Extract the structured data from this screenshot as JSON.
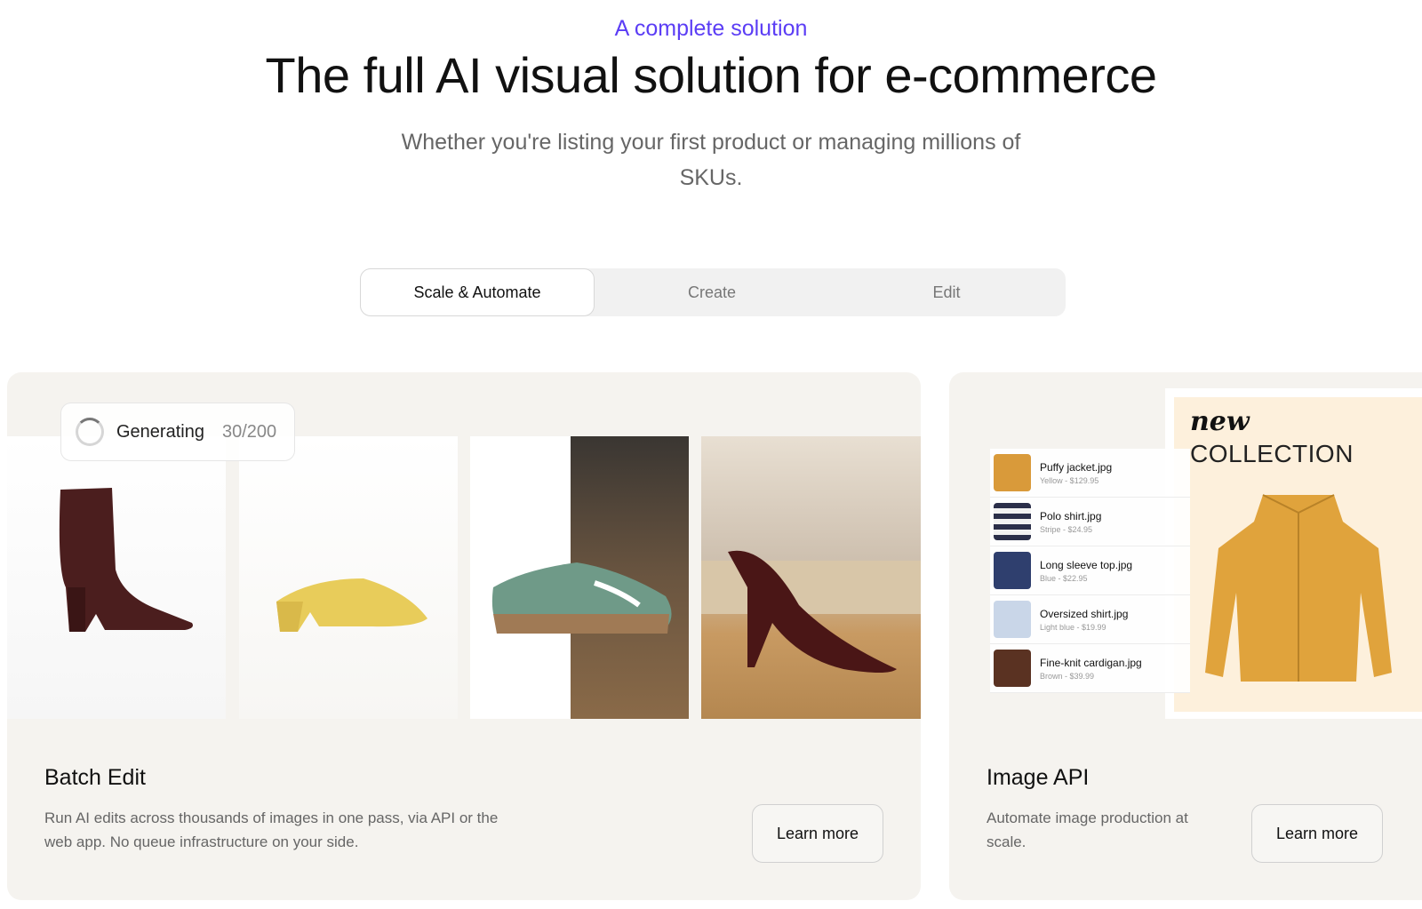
{
  "hero": {
    "eyebrow": "A complete solution",
    "title": "The full AI visual solution for e-commerce",
    "subtitle": "Whether you're listing your first product or managing millions of SKUs."
  },
  "tabs": [
    {
      "label": "Scale & Automate",
      "active": true
    },
    {
      "label": "Create",
      "active": false
    },
    {
      "label": "Edit",
      "active": false
    }
  ],
  "batch_edit": {
    "status_label": "Generating",
    "status_count": "30/200",
    "title": "Batch Edit",
    "description": "Run AI edits across thousands of images in one pass, via API or the web app. No queue infrastructure on your side.",
    "button": "Learn more"
  },
  "image_api": {
    "promo_new": "new",
    "promo_collection": "COLLECTION",
    "files": [
      {
        "name": "Puffy jacket.jpg",
        "meta": "Yellow - $129.95",
        "color": "#d99a3a"
      },
      {
        "name": "Polo shirt.jpg",
        "meta": "Stripe - $24.95",
        "color": "#2b2f4a"
      },
      {
        "name": "Long sleeve top.jpg",
        "meta": "Blue - $22.95",
        "color": "#2f3f6e"
      },
      {
        "name": "Oversized shirt.jpg",
        "meta": "Light blue - $19.99",
        "color": "#c9d6e8"
      },
      {
        "name": "Fine-knit cardigan.jpg",
        "meta": "Brown - $39.99",
        "color": "#5a3222"
      }
    ],
    "title": "Image API",
    "description": "Automate image production at scale.",
    "button": "Learn more"
  }
}
